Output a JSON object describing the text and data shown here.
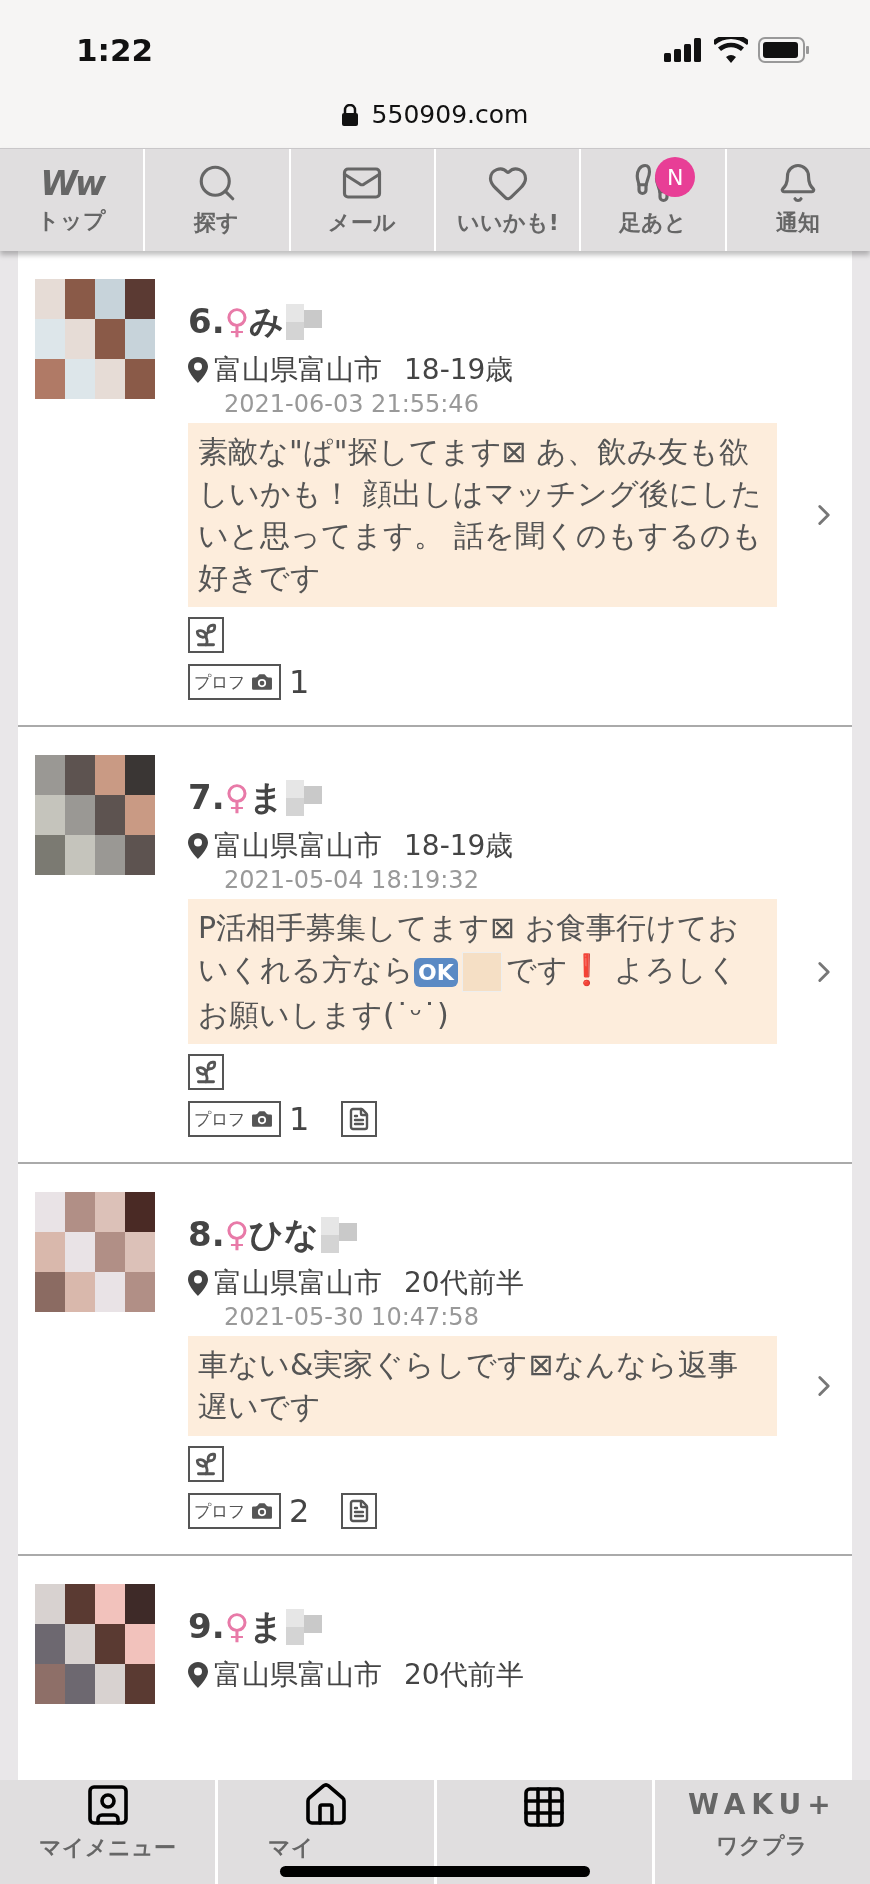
{
  "status_bar": {
    "time": "1:22"
  },
  "browser": {
    "url": "550909.com"
  },
  "top_nav": [
    {
      "kind": "logo",
      "logo": "Ww",
      "label": "トップ"
    },
    {
      "kind": "search",
      "label": "探す"
    },
    {
      "kind": "mail",
      "label": "メール"
    },
    {
      "kind": "heart",
      "label": "いいかも!"
    },
    {
      "kind": "footprints",
      "label": "足あと",
      "badge": "N"
    },
    {
      "kind": "bell",
      "label": "通知"
    }
  ],
  "profiles": [
    {
      "number": "6.",
      "gender": "♀",
      "name": "み",
      "location": "富山県富山市",
      "age": "18-19歳",
      "date": "2021-06-03 21:55:46",
      "message": [
        {
          "kind": "text",
          "text": "素敵な\"ぱ\"探してます⊠ あ、飲み友も欲しいかも！ 顔出しはマッチング後にしたいと思ってます。 話を聞くのもするのも好きです"
        }
      ],
      "prof_label": "プロフ",
      "photo_count": "1",
      "has_document": false
    },
    {
      "number": "7.",
      "gender": "♀",
      "name": "ま",
      "location": "富山県富山市",
      "age": "18-19歳",
      "date": "2021-05-04 18:19:32",
      "message": [
        {
          "kind": "text",
          "text": "P活相手募集してます⊠ お食事行けておいくれる方なら"
        },
        {
          "kind": "ok",
          "text": "OK"
        },
        {
          "kind": "blank"
        },
        {
          "kind": "text",
          "text": "です"
        },
        {
          "kind": "exclaim",
          "text": "❗"
        },
        {
          "kind": "text",
          "text": " よろしくお願いします(˙ᵕ˙)"
        }
      ],
      "prof_label": "プロフ",
      "photo_count": "1",
      "has_document": true
    },
    {
      "number": "8.",
      "gender": "♀",
      "name": "ひな",
      "location": "富山県富山市",
      "age": "20代前半",
      "date": "2021-05-30 10:47:58",
      "message": [
        {
          "kind": "text",
          "text": "車ない&実家ぐらしです⊠なんなら返事遅いです"
        }
      ],
      "prof_label": "プロフ",
      "photo_count": "2",
      "has_document": true
    },
    {
      "number": "9.",
      "gender": "♀",
      "name": "ま",
      "location": "富山県富山市",
      "age": "20代前半"
    }
  ],
  "bottom_nav": [
    {
      "kind": "user",
      "label": "マイメニュー"
    },
    {
      "kind": "home",
      "label": "マイ"
    },
    {
      "kind": "grid"
    },
    {
      "kind": "logo",
      "logo": "WAKU+",
      "label": "ワクプラ"
    }
  ]
}
